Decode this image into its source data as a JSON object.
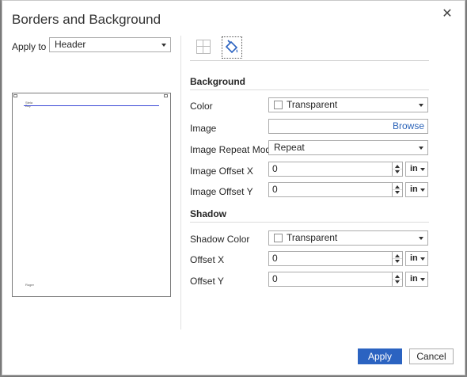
{
  "dialog": {
    "title": "Borders and Background",
    "close_glyph": "✕"
  },
  "apply_to": {
    "label": "Apply to",
    "value": "Header"
  },
  "preview": {
    "text_top": "Stela\nBuy",
    "text_bottom": "Roger"
  },
  "tabs": [
    {
      "icon": "borders-icon"
    },
    {
      "icon": "paint-bucket-icon"
    }
  ],
  "background": {
    "heading": "Background",
    "color_label": "Color",
    "color_value": "Transparent",
    "image_label": "Image",
    "image_value": "",
    "browse": "Browse",
    "repeat_label": "Image Repeat Mode",
    "repeat_value": "Repeat",
    "offset_x_label": "Image Offset X",
    "offset_x_value": "0",
    "offset_x_unit": "in",
    "offset_y_label": "Image Offset Y",
    "offset_y_value": "0",
    "offset_y_unit": "in"
  },
  "shadow": {
    "heading": "Shadow",
    "color_label": "Shadow Color",
    "color_value": "Transparent",
    "offset_x_label": "Offset X",
    "offset_x_value": "0",
    "offset_x_unit": "in",
    "offset_y_label": "Offset Y",
    "offset_y_value": "0",
    "offset_y_unit": "in"
  },
  "buttons": {
    "apply": "Apply",
    "cancel": "Cancel"
  },
  "colors": {
    "accent": "#2b63c1",
    "link": "#2b63b8",
    "preview_line": "#3b49d6"
  }
}
